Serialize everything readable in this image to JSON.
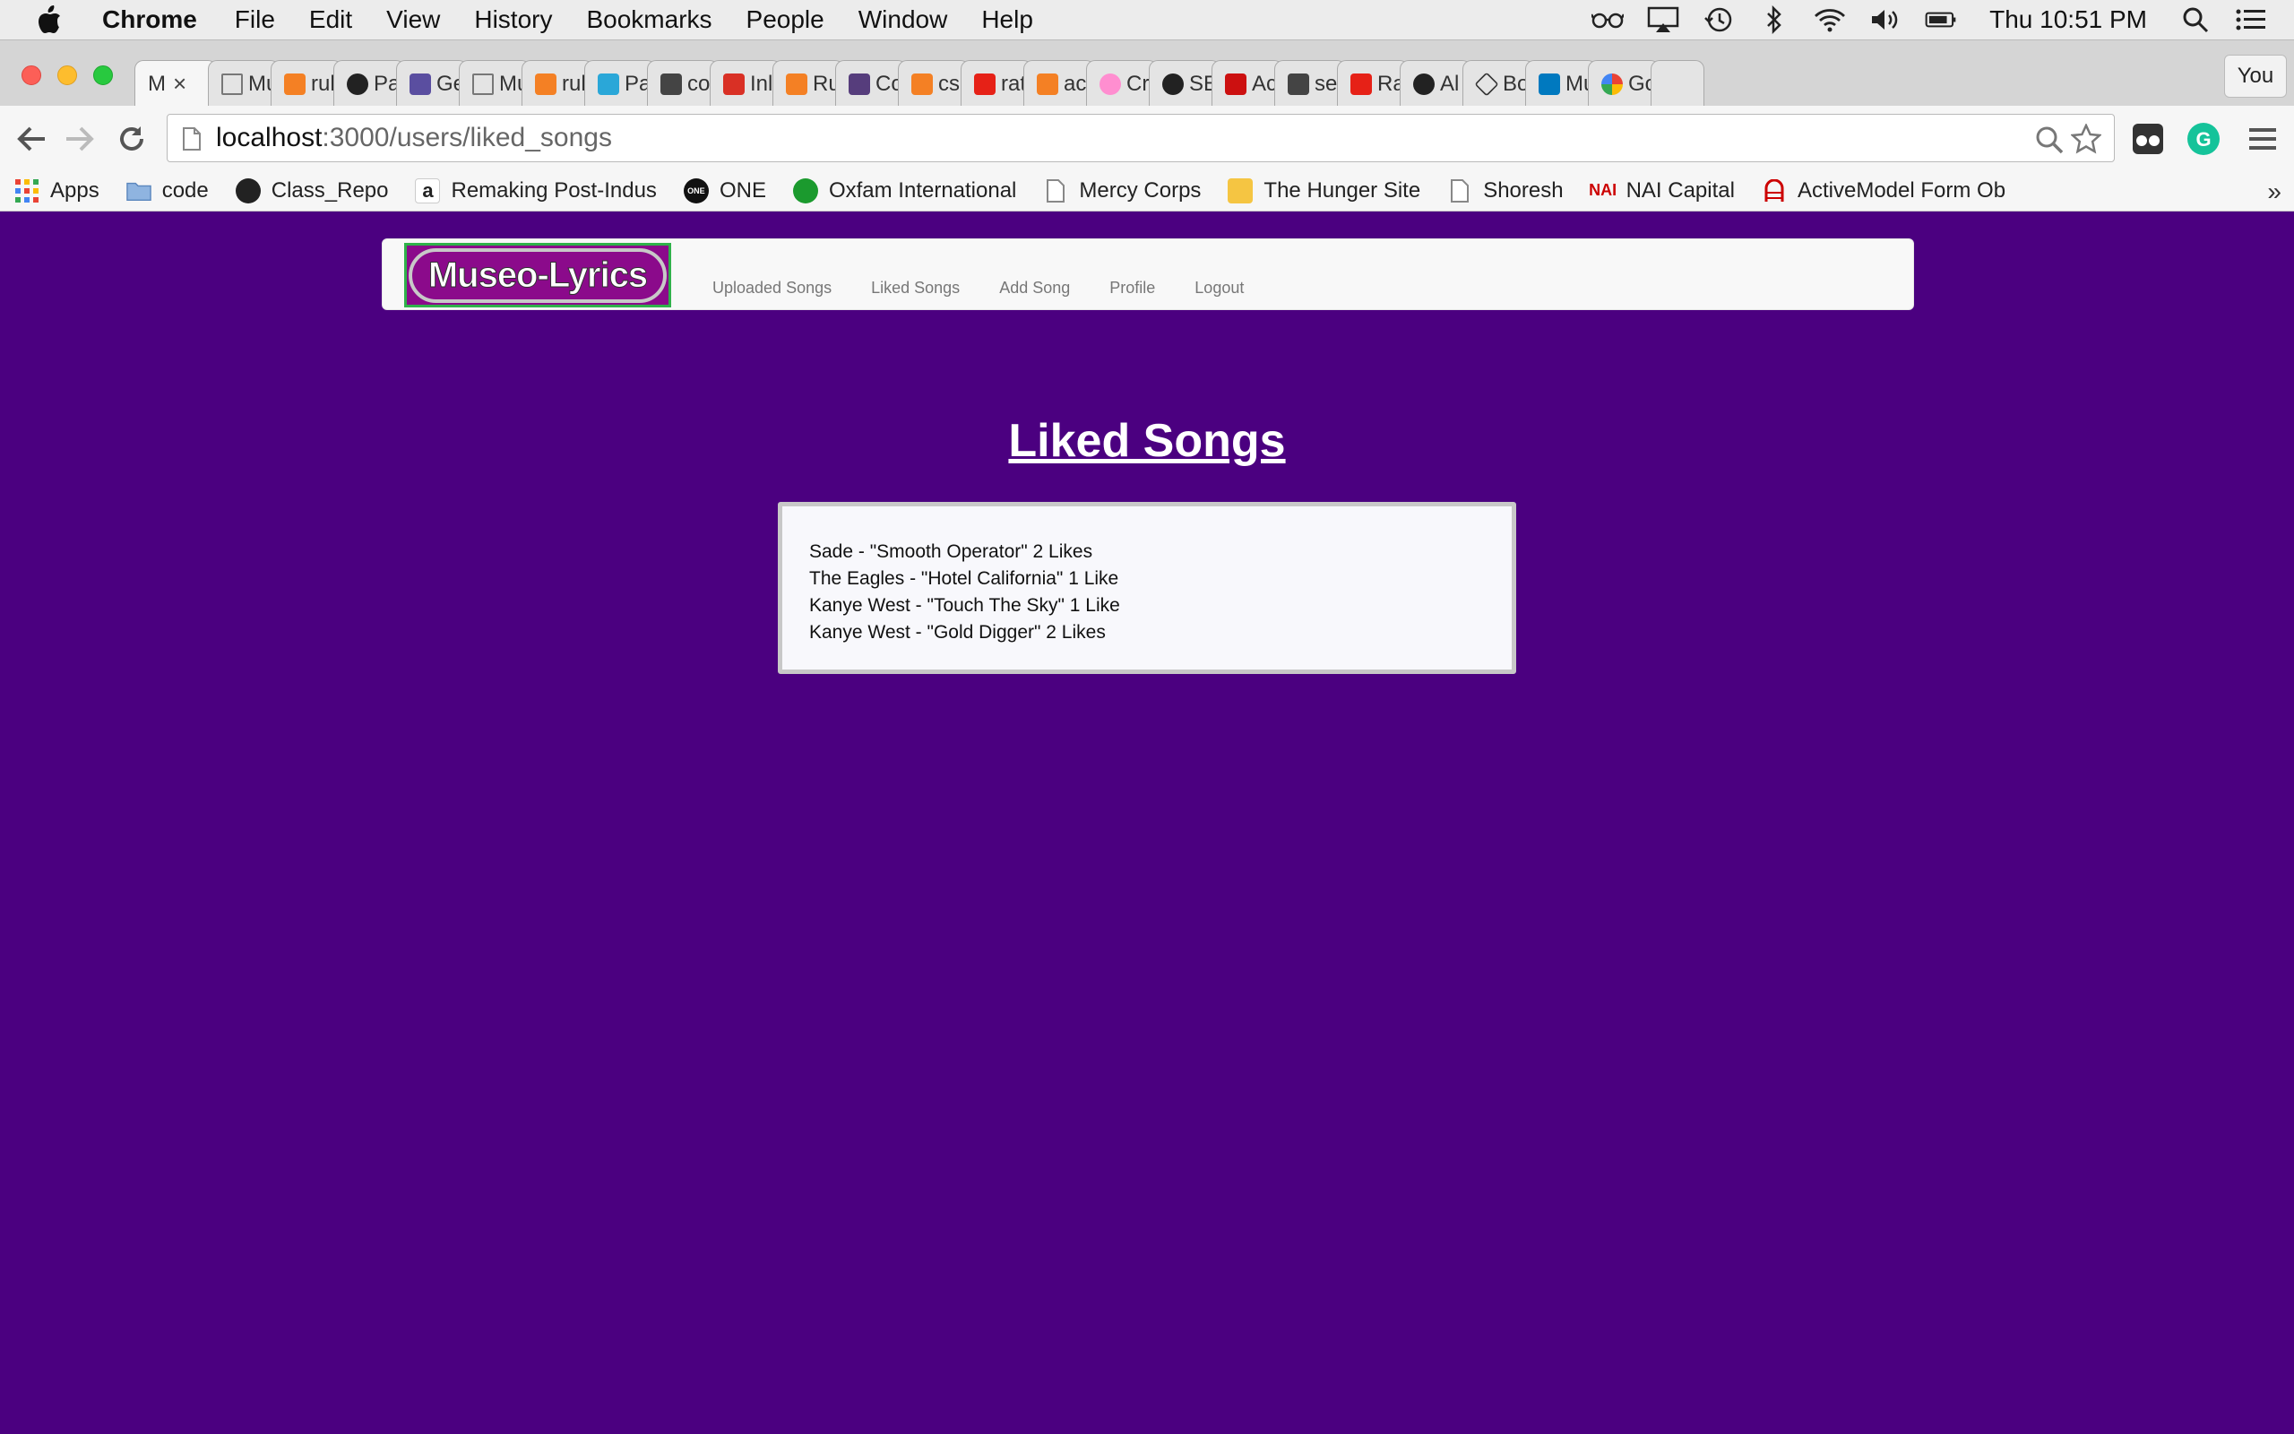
{
  "menubar": {
    "app_name": "Chrome",
    "items": [
      "File",
      "Edit",
      "View",
      "History",
      "Bookmarks",
      "People",
      "Window",
      "Help"
    ],
    "clock": "Thu 10:51 PM"
  },
  "tabs": {
    "active_label": "M",
    "close_glyph": "×",
    "labels": [
      "Mu",
      "rul",
      "Pa",
      "Ge",
      "Mu",
      "rul",
      "Pa",
      "co",
      "Inl",
      "Ru",
      "Co",
      "cs",
      "rat",
      "ac",
      "Cr",
      "SE",
      "Ac",
      "se",
      "Ra",
      "Al",
      "Bo",
      "Mu",
      "Go"
    ],
    "profile_label": "You"
  },
  "toolbar": {
    "url_host": "localhost",
    "url_rest": ":3000/users/liked_songs"
  },
  "bookmarks": [
    "Apps",
    "code",
    "Class_Repo",
    "Remaking Post-Indus",
    "ONE",
    "Oxfam International",
    "Mercy Corps",
    "The Hunger Site",
    "Shoresh",
    "NAI Capital",
    "ActiveModel Form Ob"
  ],
  "site": {
    "logo": "Museo-Lyrics",
    "nav": [
      "Uploaded Songs",
      "Liked Songs",
      "Add Song",
      "Profile",
      "Logout"
    ]
  },
  "main": {
    "heading": "Liked Songs",
    "songs": [
      "Sade - \"Smooth Operator\" 2 Likes",
      "The Eagles - \"Hotel California\" 1 Like",
      "Kanye West - \"Touch The Sky\" 1 Like",
      "Kanye West - \"Gold Digger\" 2 Likes"
    ]
  },
  "colors": {
    "page_background": "#4b0080",
    "logo_background": "#8b0a8b",
    "logo_border": "#2fb24a"
  }
}
